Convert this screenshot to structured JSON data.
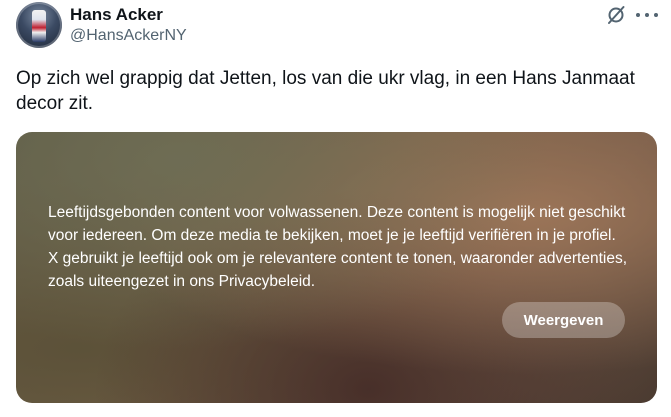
{
  "author": {
    "display_name": "Hans Acker",
    "handle": "@HansAckerNY"
  },
  "header_icons": {
    "grok": "grok-icon",
    "more": "more-icon"
  },
  "post": {
    "text": "Op zich wel grappig dat Jetten, los van die ukr vlag, in een Hans Janmaat decor zit."
  },
  "media": {
    "warning_text": "Leeftijdsgebonden content voor volwassenen. Deze content is mogelijk niet geschikt voor iedereen. Om deze media te bekijken, moet je je leeftijd verifiëren in je profiel. X gebruikt je leeftijd ook om je relevantere content te tonen, waaronder advertenties, zoals uiteengezet in ons Privacybeleid.",
    "show_button_label": "Weergeven"
  },
  "colors": {
    "text_primary": "#0f1419",
    "text_secondary": "#536471"
  }
}
